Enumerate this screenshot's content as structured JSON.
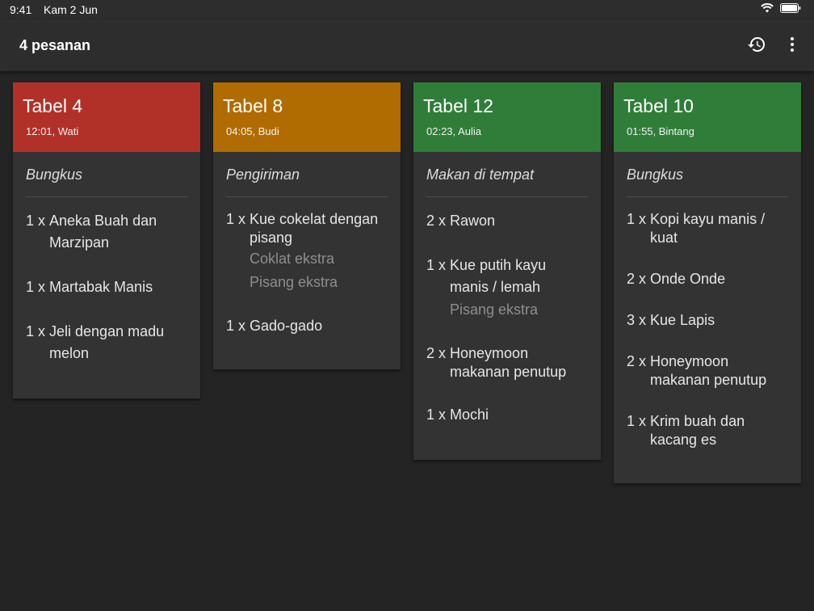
{
  "status_bar": {
    "time": "9:41",
    "date": "Kam 2 Jun"
  },
  "app_bar": {
    "title": "4 pesanan",
    "history_icon": "history-icon",
    "menu_icon": "more-vert-icon"
  },
  "colors": {
    "red": "#b13027",
    "orange": "#b06c00",
    "green": "#2f7d39"
  },
  "orders": [
    {
      "table": "Tabel 4",
      "meta": "12:01, Wati",
      "type": "Bungkus",
      "color": "#b13027",
      "items": [
        {
          "qty": "1 x",
          "name": "Aneka Buah dan Marzipan",
          "extras": []
        },
        {
          "qty": "1 x",
          "name": "Martabak Manis",
          "extras": []
        },
        {
          "qty": "1 x",
          "name": "Jeli dengan madu melon",
          "extras": []
        }
      ]
    },
    {
      "table": "Tabel 8",
      "meta": "04:05, Budi",
      "type": "Pengiriman",
      "color": "#b06c00",
      "items": [
        {
          "qty": "1 x",
          "name": "Kue cokelat dengan pisang",
          "extras": [
            "Coklat ekstra",
            "Pisang ekstra"
          ]
        },
        {
          "qty": "1 x",
          "name": "Gado-gado",
          "extras": []
        }
      ]
    },
    {
      "table": "Tabel 12",
      "meta": "02:23, Aulia",
      "type": "Makan di tempat",
      "color": "#2f7d39",
      "items": [
        {
          "qty": "2 x",
          "name": "Rawon",
          "extras": []
        },
        {
          "qty": "1 x",
          "name": "Kue putih kayu manis / lemah",
          "extras": [
            "Pisang ekstra"
          ]
        },
        {
          "qty": "2 x",
          "name": "Honeymoon makanan penutup",
          "extras": []
        },
        {
          "qty": "1 x",
          "name": "Mochi",
          "extras": []
        }
      ]
    },
    {
      "table": "Tabel 10",
      "meta": "01:55, Bintang",
      "type": "Bungkus",
      "color": "#2f7d39",
      "items": [
        {
          "qty": "1 x",
          "name": "Kopi kayu manis / kuat",
          "extras": []
        },
        {
          "qty": "2 x",
          "name": "Onde Onde",
          "extras": []
        },
        {
          "qty": "3 x",
          "name": "Kue Lapis",
          "extras": []
        },
        {
          "qty": "2 x",
          "name": "Honeymoon makanan penutup",
          "extras": []
        },
        {
          "qty": "1 x",
          "name": "Krim buah dan kacang es",
          "extras": []
        }
      ]
    }
  ]
}
